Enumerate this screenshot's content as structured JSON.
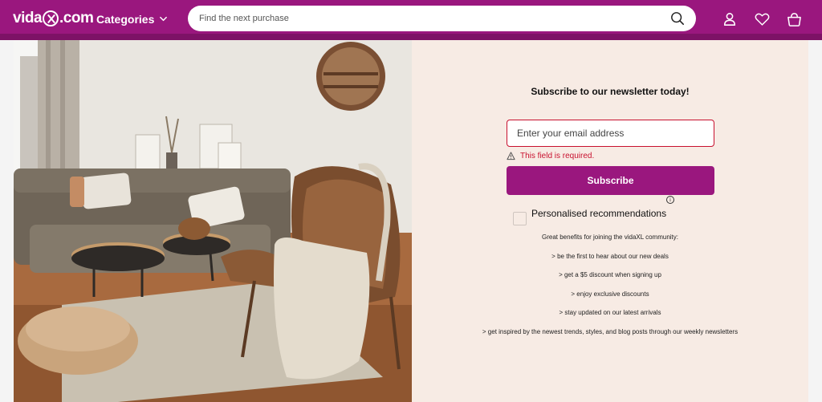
{
  "header": {
    "logo": {
      "prefix": "vida",
      "suffix": ".com"
    },
    "categories_label": "Categories",
    "search": {
      "placeholder": "Find the next purchase",
      "value": ""
    },
    "icons": [
      "search-icon",
      "account-icon",
      "heart-icon",
      "basket-icon",
      "chevron-down-icon"
    ]
  },
  "newsletter": {
    "title": "Subscribe to our newsletter today!",
    "email_placeholder": "Enter your email address",
    "email_value": "",
    "error": "This field is required.",
    "subscribe_label": "Subscribe",
    "recommendations_label": "Personalised recommendations",
    "info_symbol": "i",
    "benefits": [
      "Great benefits for joining the vidaXL community:",
      "> be the first to hear about our new deals",
      "> get a $5 discount when signing up",
      "> enjoy exclusive discounts",
      "> stay updated on our latest arrivals",
      "> get inspired by the newest trends, styles, and blog posts through our weekly newsletters"
    ]
  },
  "colors": {
    "brand": "#9a177e",
    "panel": "#f7ebe4",
    "error": "#c8102e"
  }
}
